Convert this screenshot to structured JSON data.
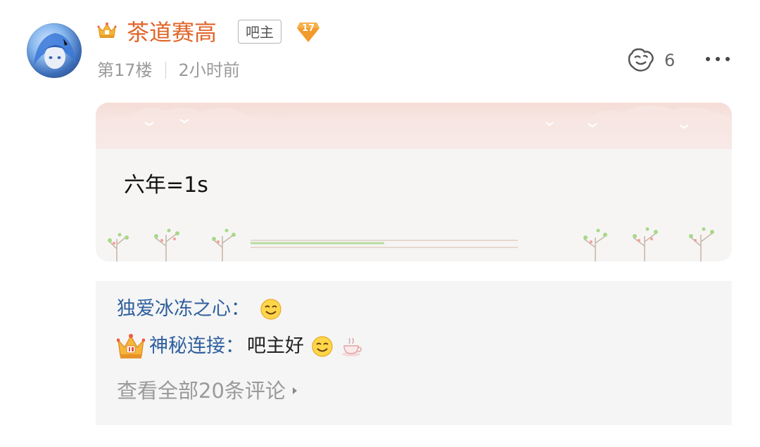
{
  "post": {
    "author": {
      "name": "茶道赛高",
      "role_badge": "吧主",
      "level": "17",
      "crown_icon": "crown-icon"
    },
    "floor": "第17楼",
    "time": "2小时前",
    "likes": "6",
    "content": "六年=1s"
  },
  "comments": [
    {
      "author": "独爱冰冻之心",
      "colon": "：",
      "text": "",
      "emoji": "smile-emoji"
    },
    {
      "author": "神秘连接",
      "colon": "：",
      "text": "吧主好",
      "emoji": "smile-emoji",
      "extra_emoji": "coffee-emoji",
      "has_crown": true
    }
  ],
  "view_all_label": "查看全部20条评论",
  "colors": {
    "username": "#e0652a",
    "comment_name": "#2f5f9f",
    "meta_gray": "#9a9a9a",
    "level_badge": "#f39a2c"
  }
}
